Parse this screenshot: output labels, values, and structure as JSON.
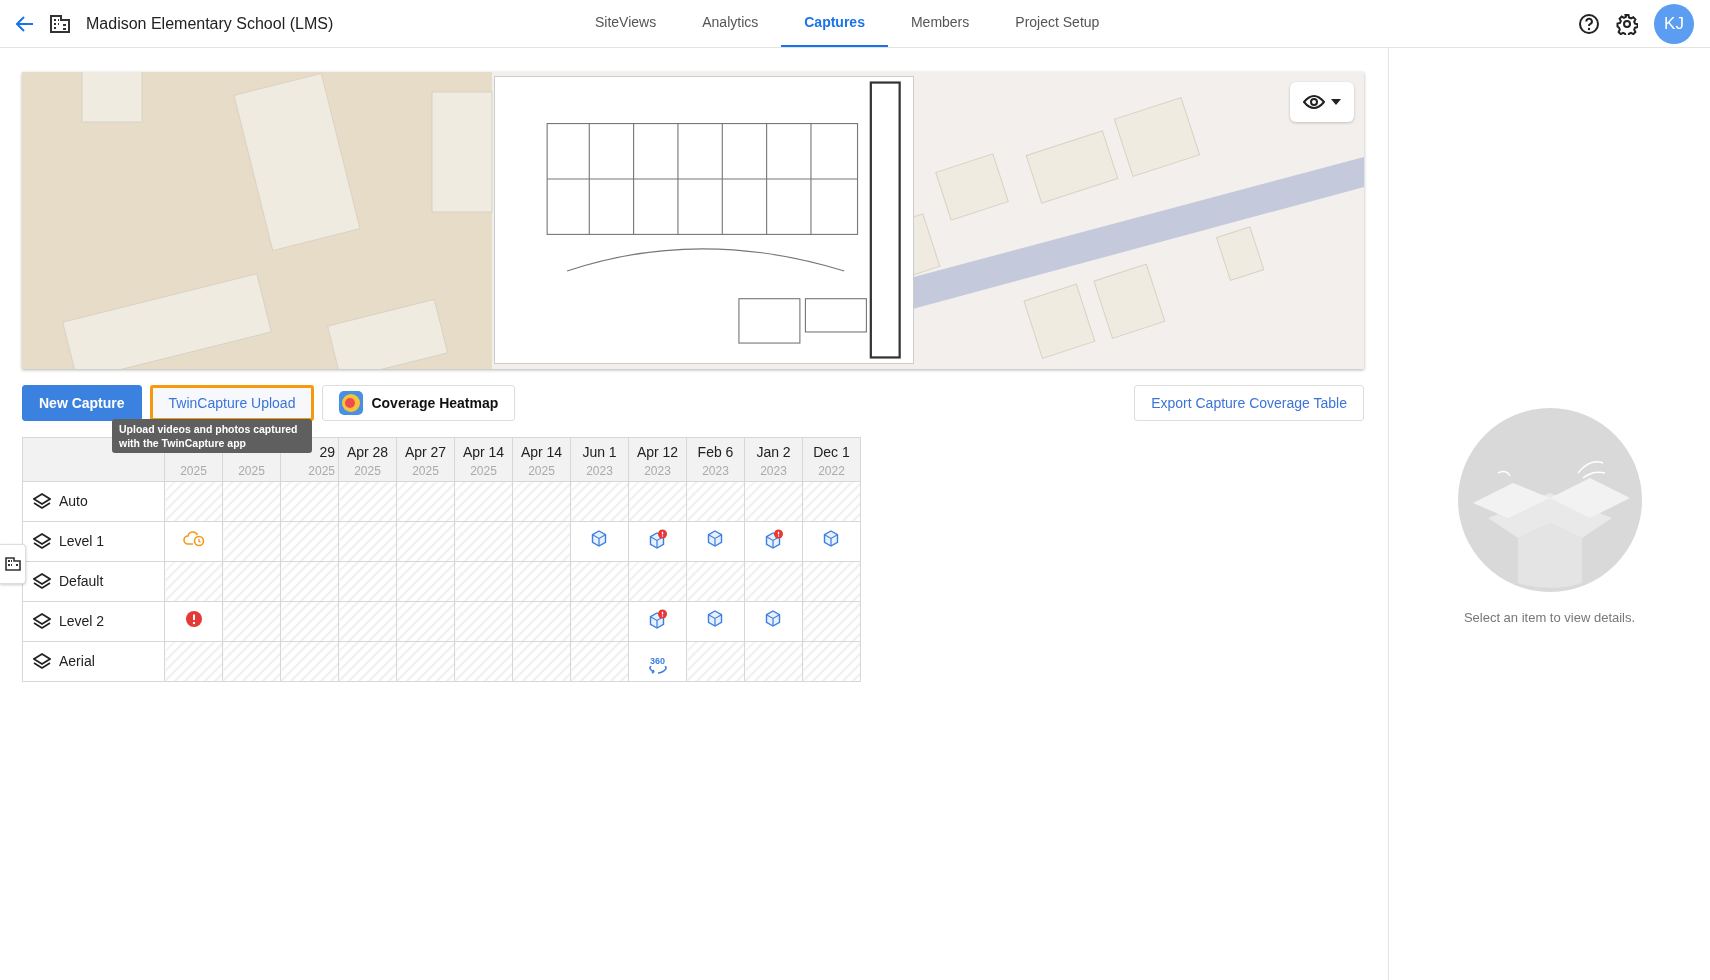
{
  "header": {
    "title": "Madison Elementary School (LMS)",
    "avatar": "KJ",
    "tabs": [
      {
        "label": "SiteViews",
        "selected": false
      },
      {
        "label": "Analytics",
        "selected": false
      },
      {
        "label": "Captures",
        "selected": true
      },
      {
        "label": "Members",
        "selected": false
      },
      {
        "label": "Project Setup",
        "selected": false
      }
    ]
  },
  "toolbar": {
    "buttons": [
      {
        "label": "New Capture",
        "kind": "primary",
        "highlighted": false
      },
      {
        "label": "TwinCapture Upload",
        "kind": "outline",
        "highlighted": true
      },
      {
        "label": "Coverage Heatmap",
        "kind": "heatmap",
        "highlighted": false
      }
    ],
    "export": "Export Capture Coverage Table"
  },
  "tooltip": "Upload videos and photos captured with the TwinCapture app",
  "table": {
    "columns": [
      {
        "year": "2025"
      },
      {
        "year": "2025"
      },
      {
        "date": "29",
        "year": "2025"
      },
      {
        "date": "Apr 28",
        "year": "2025"
      },
      {
        "date": "Apr 27",
        "year": "2025"
      },
      {
        "date": "Apr 14",
        "year": "2025"
      },
      {
        "date": "Apr 14",
        "year": "2025"
      },
      {
        "date": "Jun 1",
        "year": "2023"
      },
      {
        "date": "Apr 12",
        "year": "2023"
      },
      {
        "date": "Feb 6",
        "year": "2023"
      },
      {
        "date": "Jan 2",
        "year": "2023"
      },
      {
        "date": "Dec 1",
        "year": "2022"
      }
    ],
    "rows": [
      {
        "name": "Auto",
        "cells": [
          {
            "kind": "empty"
          },
          {
            "kind": "empty"
          },
          {
            "kind": "empty"
          },
          {
            "kind": "empty"
          },
          {
            "kind": "empty"
          },
          {
            "kind": "empty"
          },
          {
            "kind": "empty"
          },
          {
            "kind": "empty"
          },
          {
            "kind": "empty"
          },
          {
            "kind": "empty"
          },
          {
            "kind": "empty"
          },
          {
            "kind": "empty"
          }
        ]
      },
      {
        "name": "Level 1",
        "cells": [
          {
            "kind": "pending"
          },
          {
            "kind": "empty"
          },
          {
            "kind": "empty"
          },
          {
            "kind": "empty"
          },
          {
            "kind": "empty"
          },
          {
            "kind": "empty"
          },
          {
            "kind": "empty"
          },
          {
            "kind": "capture"
          },
          {
            "kind": "alert"
          },
          {
            "kind": "capture"
          },
          {
            "kind": "alert"
          },
          {
            "kind": "capture"
          }
        ]
      },
      {
        "name": "Default",
        "cells": [
          {
            "kind": "empty"
          },
          {
            "kind": "empty"
          },
          {
            "kind": "empty"
          },
          {
            "kind": "empty"
          },
          {
            "kind": "empty"
          },
          {
            "kind": "empty"
          },
          {
            "kind": "empty"
          },
          {
            "kind": "empty"
          },
          {
            "kind": "empty"
          },
          {
            "kind": "empty"
          },
          {
            "kind": "empty"
          },
          {
            "kind": "empty"
          }
        ]
      },
      {
        "name": "Level 2",
        "cells": [
          {
            "kind": "error"
          },
          {
            "kind": "empty"
          },
          {
            "kind": "empty"
          },
          {
            "kind": "empty"
          },
          {
            "kind": "empty"
          },
          {
            "kind": "empty"
          },
          {
            "kind": "empty"
          },
          {
            "kind": "empty"
          },
          {
            "kind": "alert"
          },
          {
            "kind": "capture"
          },
          {
            "kind": "capture"
          },
          {
            "kind": "empty"
          }
        ]
      },
      {
        "name": "Aerial",
        "cells": [
          {
            "kind": "empty"
          },
          {
            "kind": "empty"
          },
          {
            "kind": "empty"
          },
          {
            "kind": "empty"
          },
          {
            "kind": "empty"
          },
          {
            "kind": "empty"
          },
          {
            "kind": "empty"
          },
          {
            "kind": "empty"
          },
          {
            "kind": "pano",
            "label": "360"
          },
          {
            "kind": "empty"
          },
          {
            "kind": "empty"
          },
          {
            "kind": "empty"
          }
        ]
      }
    ]
  },
  "details": {
    "empty_text": "Select an item to view details."
  }
}
